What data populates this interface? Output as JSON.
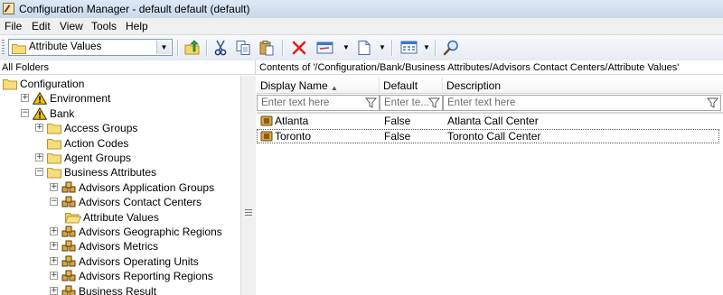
{
  "window": {
    "title": "Configuration Manager - default default (default)"
  },
  "menu": [
    {
      "label": "File"
    },
    {
      "label": "Edit"
    },
    {
      "label": "View"
    },
    {
      "label": "Tools"
    },
    {
      "label": "Help"
    }
  ],
  "toolbar": {
    "combo_value": "Attribute Values"
  },
  "left_pane": {
    "header": "All Folders",
    "tree": [
      {
        "label": "Configuration",
        "depth": 0,
        "icon": "folder-icon",
        "expander": ""
      },
      {
        "label": "Environment",
        "depth": 1,
        "icon": "warning-icon",
        "expander": "+"
      },
      {
        "label": "Bank",
        "depth": 1,
        "icon": "warning-icon",
        "expander": "−"
      },
      {
        "label": "Access Groups",
        "depth": 2,
        "icon": "folder-icon",
        "expander": "+"
      },
      {
        "label": "Action Codes",
        "depth": 2,
        "icon": "folder-icon",
        "expander": ""
      },
      {
        "label": "Agent Groups",
        "depth": 2,
        "icon": "folder-icon",
        "expander": "+"
      },
      {
        "label": "Business Attributes",
        "depth": 2,
        "icon": "folder-icon",
        "expander": "−"
      },
      {
        "label": "Advisors Application Groups",
        "depth": 3,
        "icon": "attribute-stack-icon",
        "expander": "+"
      },
      {
        "label": "Advisors Contact Centers",
        "depth": 3,
        "icon": "attribute-stack-icon",
        "expander": "−"
      },
      {
        "label": "Attribute Values",
        "depth": 4,
        "icon": "open-folder-icon",
        "expander": ""
      },
      {
        "label": "Advisors Geographic Regions",
        "depth": 3,
        "icon": "attribute-stack-icon",
        "expander": "+"
      },
      {
        "label": "Advisors Metrics",
        "depth": 3,
        "icon": "attribute-stack-icon",
        "expander": "+"
      },
      {
        "label": "Advisors Operating Units",
        "depth": 3,
        "icon": "attribute-stack-icon",
        "expander": "+"
      },
      {
        "label": "Advisors Reporting Regions",
        "depth": 3,
        "icon": "attribute-stack-icon",
        "expander": "+"
      },
      {
        "label": "Business Result",
        "depth": 3,
        "icon": "attribute-stack-icon",
        "expander": "+"
      }
    ]
  },
  "right_pane": {
    "header": "Contents of '/Configuration/Bank/Business Attributes/Advisors Contact Centers/Attribute Values'",
    "columns": [
      {
        "label": "Display Name",
        "filter_placeholder": "Enter text here"
      },
      {
        "label": "Default",
        "filter_placeholder": "Enter te..."
      },
      {
        "label": "Description",
        "filter_placeholder": "Enter text here"
      }
    ],
    "rows": [
      {
        "name": "Atlanta",
        "default": "False",
        "description": "Atlanta Call Center"
      },
      {
        "name": "Toronto",
        "default": "False",
        "description": "Toronto Call Center"
      }
    ]
  },
  "colors": {
    "folder": "#f5d66a",
    "warning": "#f2c200",
    "delete": "#e02020",
    "accent": "#3a78c8"
  }
}
